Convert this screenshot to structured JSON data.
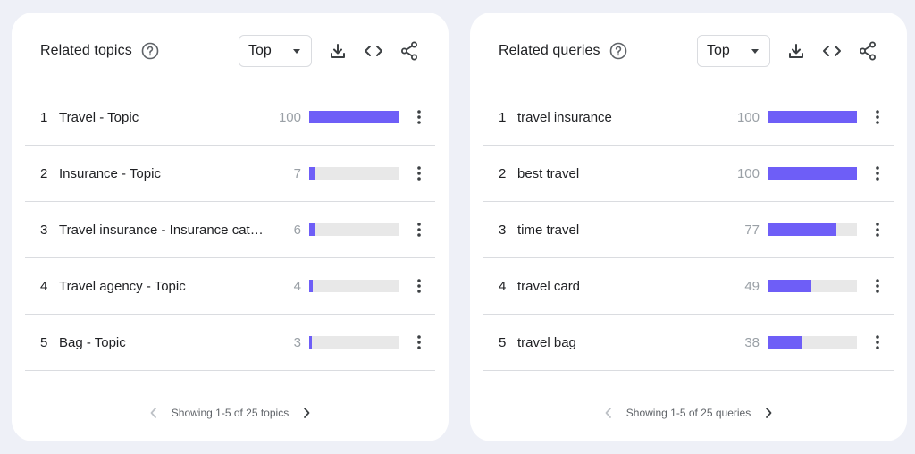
{
  "cards": {
    "topics": {
      "title": "Related topics",
      "select_value": "Top",
      "pager_text": "Showing 1-5 of 25 topics",
      "rows": [
        {
          "index": "1",
          "label": "Travel - Topic",
          "value": "100",
          "level": 100
        },
        {
          "index": "2",
          "label": "Insurance - Topic",
          "value": "7",
          "level": 7
        },
        {
          "index": "3",
          "label": "Travel insurance - Insurance category",
          "value": "6",
          "level": 6
        },
        {
          "index": "4",
          "label": "Travel agency - Topic",
          "value": "4",
          "level": 4
        },
        {
          "index": "5",
          "label": "Bag - Topic",
          "value": "3",
          "level": 3
        }
      ]
    },
    "queries": {
      "title": "Related queries",
      "select_value": "Top",
      "pager_text": "Showing 1-5 of 25 queries",
      "rows": [
        {
          "index": "1",
          "label": "travel insurance",
          "value": "100",
          "level": 100
        },
        {
          "index": "2",
          "label": "best travel",
          "value": "100",
          "level": 100
        },
        {
          "index": "3",
          "label": "time travel",
          "value": "77",
          "level": 77
        },
        {
          "index": "4",
          "label": "travel card",
          "value": "49",
          "level": 49
        },
        {
          "index": "5",
          "label": "travel bag",
          "value": "38",
          "level": 38
        }
      ]
    }
  },
  "icons": {
    "help": "help-circle-icon",
    "download": "download-icon",
    "embed": "code-embed-icon",
    "share": "share-icon",
    "row_menu": "more-vert-icon",
    "prev": "chevron-left-icon",
    "next": "chevron-right-icon"
  },
  "colors": {
    "bar_fill": "#6e5ef7",
    "bar_track": "#e8e8e8",
    "page_background": "#eef0f7"
  }
}
